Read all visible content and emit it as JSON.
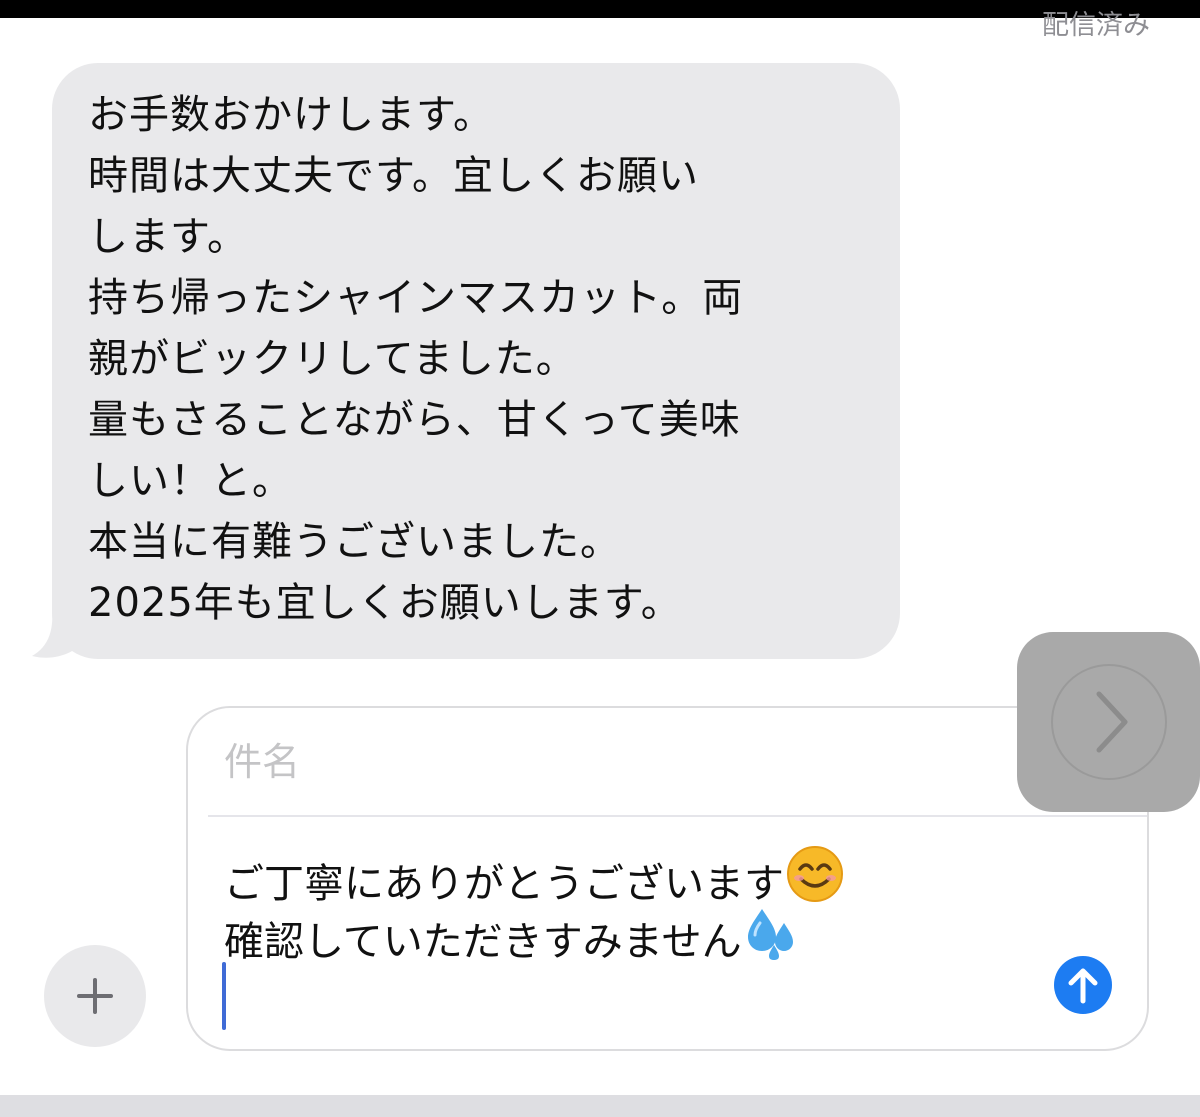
{
  "thread": {
    "delivery_status": "配信済み"
  },
  "received_message": {
    "lines": [
      "お手数おかけします。",
      "時間は大丈夫です。宜しくお願い",
      "します。",
      "持ち帰ったシャインマスカット。両",
      "親がビックリしてました。",
      "量もさることながら、甘くって美味",
      "しい！と。",
      "本当に有難うございました。",
      "2025年も宜しくお願いします。"
    ]
  },
  "composer": {
    "subject_placeholder": "件名",
    "draft_lines": [
      "ご丁寧にありがとうございます",
      "確認していただきすみません"
    ],
    "emoji": [
      "smiling-face",
      "sweat-droplets"
    ]
  },
  "colors": {
    "bubble_gray": "#e9e9eb",
    "send_blue": "#1d7cf2",
    "caret_blue": "#3f6bd6",
    "overlay_gray": "#a9a9a9"
  },
  "icons": {
    "send": "arrow-up-icon",
    "attach": "plus-icon",
    "overlay": "chevron-right-icon"
  }
}
